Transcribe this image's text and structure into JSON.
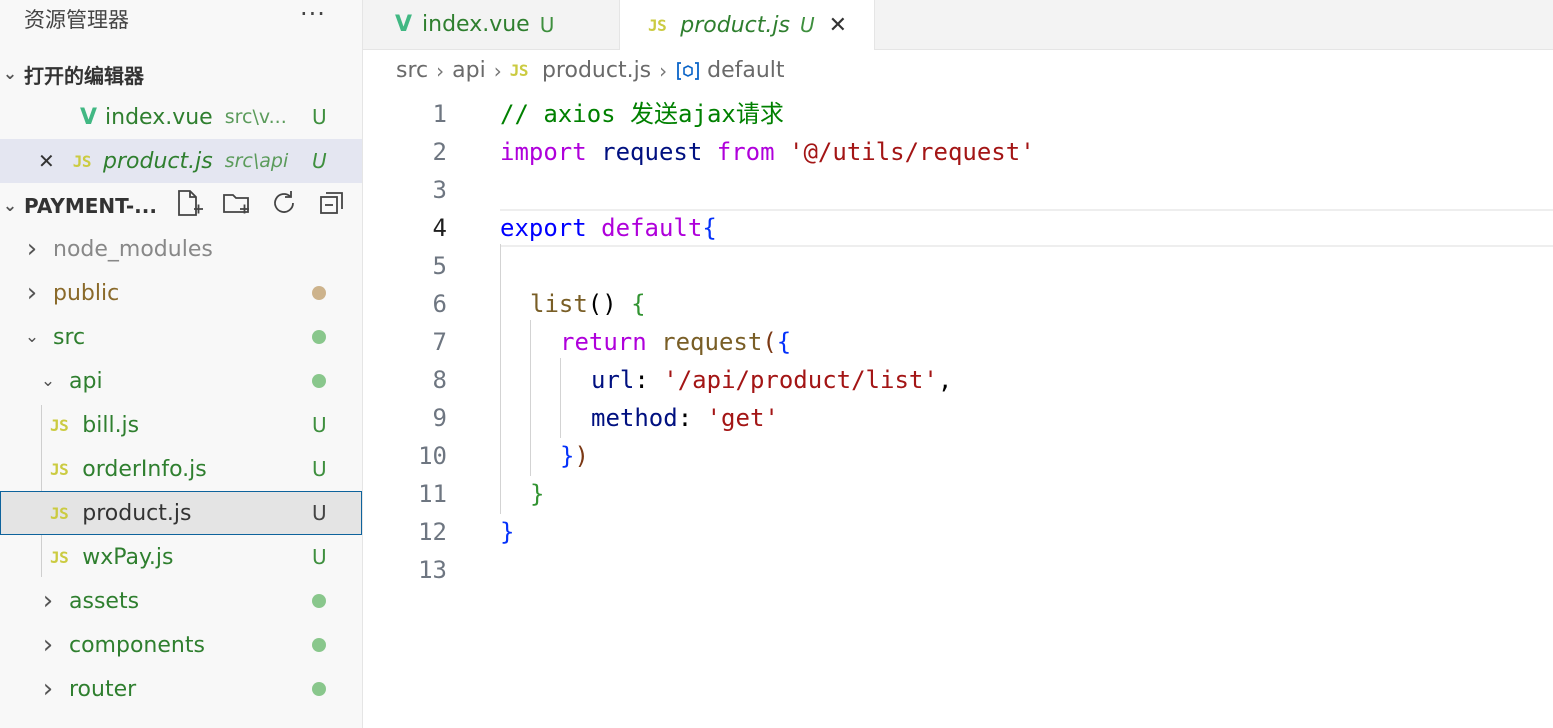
{
  "sidebar": {
    "title": "资源管理器",
    "more_label": "···",
    "open_editors_label": "打开的编辑器",
    "open_editors": [
      {
        "name": "index.vue",
        "path": "src\\v...",
        "status": "U"
      },
      {
        "name": "product.js",
        "path": "src\\api",
        "status": "U"
      }
    ],
    "project_label": "PAYMENT-...",
    "tree": [
      {
        "name": "node_modules"
      },
      {
        "name": "public"
      },
      {
        "name": "src"
      },
      {
        "name": "api"
      },
      {
        "name": "bill.js",
        "status": "U"
      },
      {
        "name": "orderInfo.js",
        "status": "U"
      },
      {
        "name": "product.js",
        "status": "U"
      },
      {
        "name": "wxPay.js",
        "status": "U"
      },
      {
        "name": "assets"
      },
      {
        "name": "components"
      },
      {
        "name": "router"
      }
    ]
  },
  "tabs": [
    {
      "label": "index.vue",
      "status": "U"
    },
    {
      "label": "product.js",
      "status": "U"
    }
  ],
  "breadcrumb": [
    "src",
    "api",
    "product.js",
    "default"
  ],
  "icons": {
    "js": "JS",
    "vue": "V",
    "close": "✕",
    "chevron_right": "›",
    "chevron_down": "⌄"
  },
  "editor": {
    "current_line": 4,
    "line_numbers": [
      "1",
      "2",
      "3",
      "4",
      "5",
      "6",
      "7",
      "8",
      "9",
      "10",
      "11",
      "12",
      "13"
    ],
    "tokens": {
      "l1_comment": "// axios 发送ajax请求",
      "l2_import": "import",
      "l2_request": "request",
      "l2_from": "from",
      "l2_path": "'@/utils/request'",
      "l4_export": "export",
      "l4_default": "default",
      "l4_brace": "{",
      "l6_list": "list",
      "l6_paren": "()",
      "l6_brace": "{",
      "l7_return": "return",
      "l7_request": "request",
      "l7_paren": "(",
      "l7_brace": "{",
      "l8_key": "url",
      "l8_colon": ":",
      "l8_val": "'/api/product/list'",
      "l8_comma": ",",
      "l9_key": "method",
      "l9_colon": ":",
      "l9_val": "'get'",
      "l10_brace": "}",
      "l10_paren": ")",
      "l11_brace": "}",
      "l12_brace": "}"
    }
  },
  "colors": {
    "accent": "#0e639c",
    "untracked": "#3e8f3e",
    "js_icon": "#cbcb41",
    "vue_icon": "#41b883"
  }
}
